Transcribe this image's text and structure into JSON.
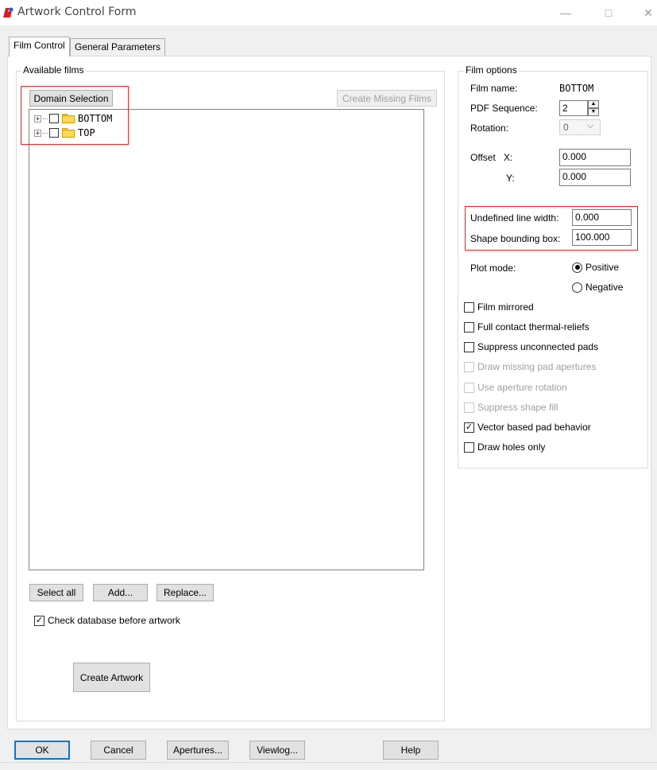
{
  "window": {
    "title": "Artwork Control Form",
    "minimize": "—",
    "maximize": "□",
    "close": "✕"
  },
  "tabs": [
    {
      "label": "Film Control",
      "active": true
    },
    {
      "label": "General Parameters",
      "active": false
    }
  ],
  "available_films": {
    "group_label": "Available films",
    "domain_selection": "Domain Selection",
    "create_missing_films": "Create Missing Films",
    "tree": [
      {
        "name": "BOTTOM",
        "expander": "+",
        "checked": false
      },
      {
        "name": "TOP",
        "expander": "+",
        "checked": false
      }
    ],
    "select_all": "Select all",
    "add": "Add...",
    "replace": "Replace...",
    "check_database_label": "Check database before artwork",
    "check_database_checked": true,
    "create_artwork": "Create Artwork"
  },
  "film_options": {
    "group_label": "Film options",
    "film_name_label": "Film name:",
    "film_name_value": "BOTTOM",
    "pdf_sequence_label": "PDF Sequence:",
    "pdf_sequence_value": "2",
    "rotation_label": "Rotation:",
    "rotation_value": "0",
    "offset_label": "Offset",
    "offset_x_label": "X:",
    "offset_x_value": "0.000",
    "offset_y_label": "Y:",
    "offset_y_value": "0.000",
    "undefined_line_width_label": "Undefined line width:",
    "undefined_line_width_value": "0.000",
    "shape_bounding_box_label": "Shape bounding box:",
    "shape_bounding_box_value": "100.000",
    "plot_mode_label": "Plot mode:",
    "plot_mode_positive": "Positive",
    "plot_mode_negative": "Negative",
    "plot_mode_selected": "Positive",
    "checkboxes": [
      {
        "label": "Film mirrored",
        "checked": false,
        "enabled": true
      },
      {
        "label": "Full contact thermal-reliefs",
        "checked": false,
        "enabled": true
      },
      {
        "label": "Suppress unconnected pads",
        "checked": false,
        "enabled": true
      },
      {
        "label": "Draw missing pad apertures",
        "checked": false,
        "enabled": false
      },
      {
        "label": "Use aperture rotation",
        "checked": false,
        "enabled": false
      },
      {
        "label": "Suppress shape fill",
        "checked": false,
        "enabled": false
      },
      {
        "label": "Vector based pad behavior",
        "checked": true,
        "enabled": true
      },
      {
        "label": "Draw holes only",
        "checked": false,
        "enabled": true
      }
    ]
  },
  "footer": {
    "ok": "OK",
    "cancel": "Cancel",
    "apertures": "Apertures...",
    "viewlog": "Viewlog...",
    "help": "Help"
  },
  "colors": {
    "highlight_box": "#e02020",
    "default_button_border": "#0078d7",
    "folder_yellow": "#ffd75a"
  }
}
